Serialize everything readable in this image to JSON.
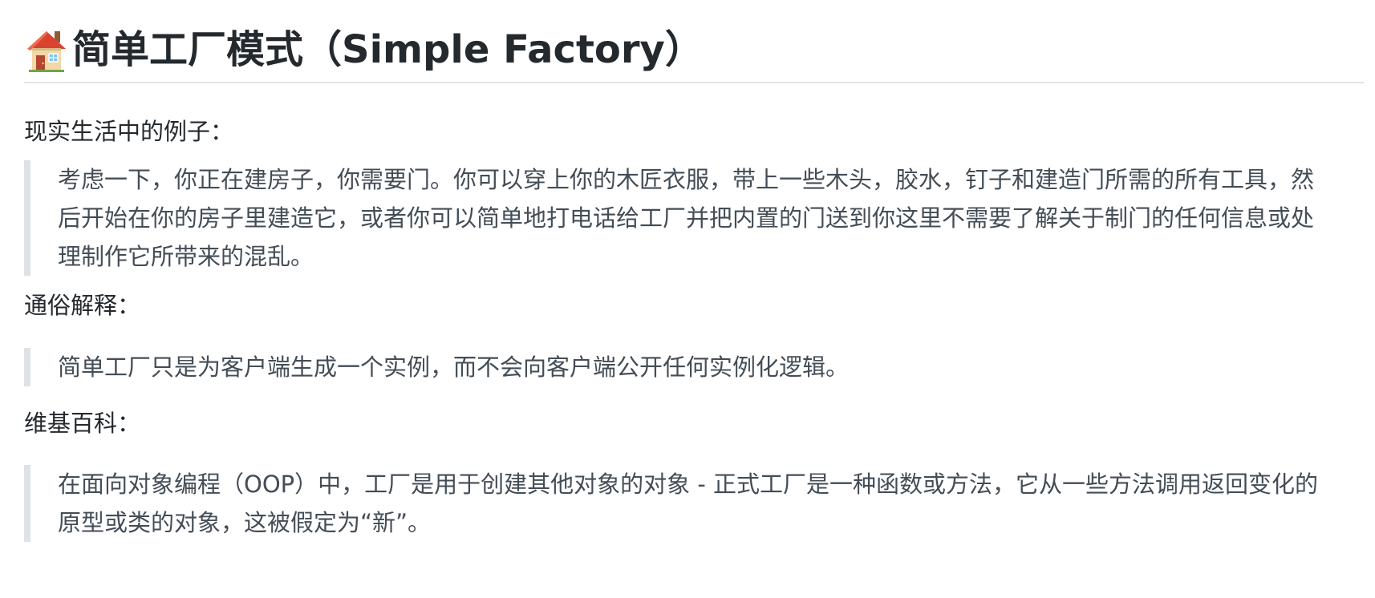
{
  "heading": {
    "icon": "house-icon",
    "title": "简单工厂模式（Simple Factory）"
  },
  "sections": [
    {
      "label": "现实生活中的例子：",
      "quote": "考虑一下，你正在建房子，你需要门。你可以穿上你的木匠衣服，带上一些木头，胶水，钉子和建造门所需的所有工具，然后开始在你的房子里建造它，或者你可以简单地打电话给工厂并把内置的门送到你这里不需要了解关于制门的任何信息或处理制作它所带来的混乱。"
    },
    {
      "label": "通俗解释：",
      "quote": "简单工厂只是为客户端生成一个实例，而不会向客户端公开任何实例化逻辑。"
    },
    {
      "label": "维基百科：",
      "quote": "在面向对象编程（OOP）中，工厂是用于创建其他对象的对象 - 正式工厂是一种函数或方法，它从一些方法调用返回变化的原型或类的对象，这被假定为“新”。"
    }
  ],
  "colors": {
    "text": "#24292e",
    "quote_text": "#444d56",
    "quote_border": "#dfe2e5",
    "rule": "#e1e4e8"
  }
}
